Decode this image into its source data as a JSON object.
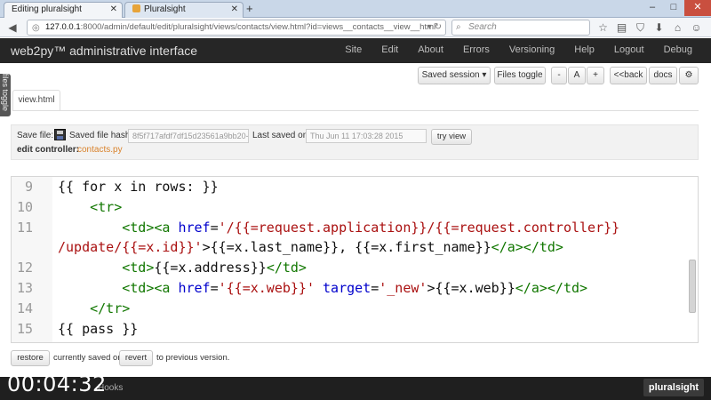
{
  "browser": {
    "tabs": [
      {
        "label": "Editing pluralsight"
      },
      {
        "label": "Pluralsight"
      }
    ],
    "url": {
      "host": "127.0.0.1",
      "path": ":8000/admin/default/edit/pluralsight/views/contacts/view.html?id=views__contacts__view__html"
    },
    "search_placeholder": "Search"
  },
  "app": {
    "title": "web2py™ administrative interface",
    "nav": [
      "Site",
      "Edit",
      "About",
      "Errors",
      "Versioning",
      "Help",
      "Logout",
      "Debug"
    ]
  },
  "sidebar": {
    "files_toggle": "files toggle"
  },
  "toolbar": {
    "saved_session": "Saved session",
    "files_toggle": "Files toggle",
    "minus": "-",
    "a": "A",
    "plus": "+",
    "back": "<<back",
    "docs": "docs"
  },
  "file_tab": "view.html",
  "savebar": {
    "save_file_label": "Save file:",
    "hash_label": "Saved file hash:",
    "hash_value": "8f5f717afdf7df15d23561a9bb20-",
    "last_saved_label": "Last saved on:",
    "last_saved_value": "Thu Jun 11 17:03:28 2015",
    "try_view": "try view",
    "edit_controller_label": "edit controller:",
    "edit_controller_link": "contacts.py"
  },
  "editor": {
    "line_numbers": [
      "9",
      "10",
      "11",
      "",
      "12",
      "13",
      "14",
      "15"
    ],
    "lines": [
      {
        "segments": [
          {
            "t": "{{ for x in rows: }}",
            "c": "plain"
          }
        ]
      },
      {
        "segments": [
          {
            "t": "    ",
            "c": "plain"
          },
          {
            "t": "<tr>",
            "c": "tag"
          }
        ]
      },
      {
        "segments": [
          {
            "t": "        ",
            "c": "plain"
          },
          {
            "t": "<td><a ",
            "c": "tag"
          },
          {
            "t": "href",
            "c": "attr"
          },
          {
            "t": "=",
            "c": "plain"
          },
          {
            "t": "'/{{=request.application}}/{{=request.controller}}",
            "c": "str"
          }
        ]
      },
      {
        "segments": [
          {
            "t": "/update/{{=x.id}}'",
            "c": "str"
          },
          {
            "t": ">{{=x.last_name}}, {{=x.first_name}}",
            "c": "plain"
          },
          {
            "t": "</a></td>",
            "c": "tag"
          }
        ]
      },
      {
        "segments": [
          {
            "t": "        ",
            "c": "plain"
          },
          {
            "t": "<td>",
            "c": "tag"
          },
          {
            "t": "{{=x.address}}",
            "c": "plain"
          },
          {
            "t": "</td>",
            "c": "tag"
          }
        ]
      },
      {
        "segments": [
          {
            "t": "        ",
            "c": "plain"
          },
          {
            "t": "<td><a ",
            "c": "tag"
          },
          {
            "t": "href",
            "c": "attr"
          },
          {
            "t": "=",
            "c": "plain"
          },
          {
            "t": "'{{=x.web}}'",
            "c": "str"
          },
          {
            "t": " ",
            "c": "plain"
          },
          {
            "t": "target",
            "c": "attr"
          },
          {
            "t": "=",
            "c": "plain"
          },
          {
            "t": "'_new'",
            "c": "str"
          },
          {
            "t": ">{{=x.web}}",
            "c": "plain"
          },
          {
            "t": "</a></td>",
            "c": "tag"
          }
        ]
      },
      {
        "segments": [
          {
            "t": "    ",
            "c": "plain"
          },
          {
            "t": "</tr>",
            "c": "tag"
          }
        ]
      },
      {
        "segments": [
          {
            "t": "{{ pass }}",
            "c": "plain"
          }
        ]
      }
    ]
  },
  "bottom": {
    "restore": "restore",
    "currently_saved": "currently saved or",
    "revert": "revert",
    "to_previous": "to previous version."
  },
  "footer": {
    "timer": "00:04:32",
    "hooks": "Hooks",
    "brand": "pluralsight"
  },
  "colors": {
    "header_bg": "#262626",
    "tag": "#117700",
    "attr": "#0000cc",
    "string": "#aa1111",
    "link": "#d9822b"
  }
}
